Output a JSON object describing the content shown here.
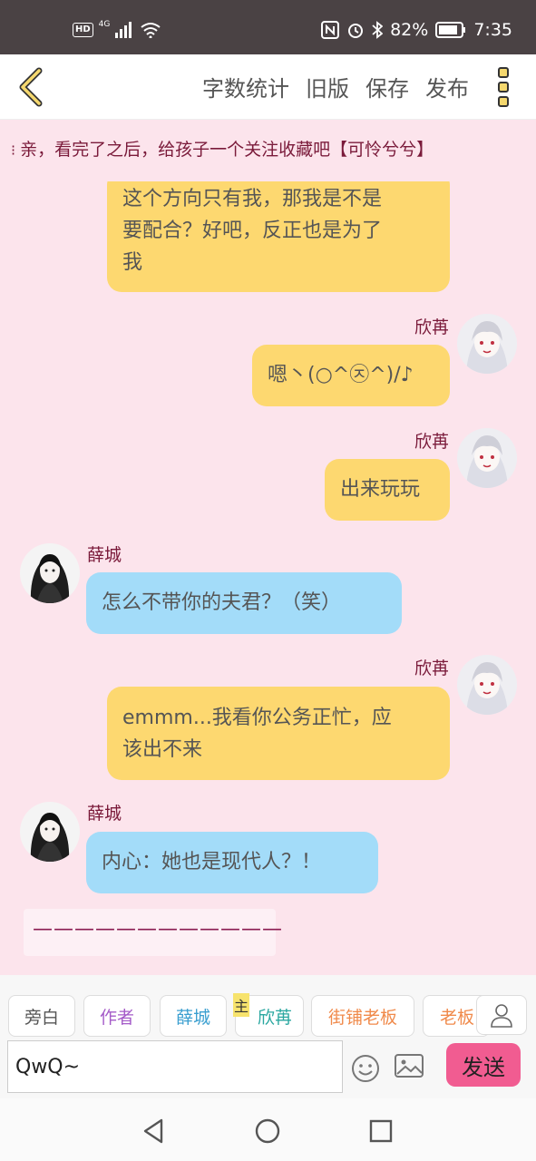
{
  "status_bar": {
    "network_badge": "HD",
    "network_type": "4G",
    "battery": "82%",
    "time": "7:35"
  },
  "toolbar": {
    "word_count": "字数统计",
    "old_version": "旧版",
    "save": "保存",
    "publish": "发布"
  },
  "notice": "亲，看完了之后，给孩子一个关注收藏吧【可怜兮兮】",
  "messages": [
    {
      "speaker": "",
      "text_lines": [
        "这个方向只有我，那我是不是",
        "要配合？好吧，反正也是为了",
        "我"
      ]
    },
    {
      "speaker": "欣苒",
      "text": "嗯丶(○^㉨^)/♪"
    },
    {
      "speaker": "欣苒",
      "text": "出来玩玩"
    },
    {
      "speaker": "薛城",
      "text": "怎么不带你的夫君？（笑）"
    },
    {
      "speaker": "欣苒",
      "text_lines": [
        "emmm...我看你公务正忙，应",
        "该出不来"
      ]
    },
    {
      "speaker": "薛城",
      "text": "内心：她也是现代人？！"
    }
  ],
  "separator": "————————————",
  "roles": {
    "narration": "旁白",
    "author": "作者",
    "xuecheng": "薛城",
    "xinran": "欣苒",
    "shop_owner": "街铺老板",
    "boss": "老板",
    "main_tag": "主"
  },
  "input": {
    "value": "QwQ~",
    "send": "发送"
  },
  "colors": {
    "yellow_bubble": "#fdd870",
    "blue_bubble": "#a3dcf9",
    "send_button": "#f15c91",
    "chat_background": "#fce4ec"
  }
}
